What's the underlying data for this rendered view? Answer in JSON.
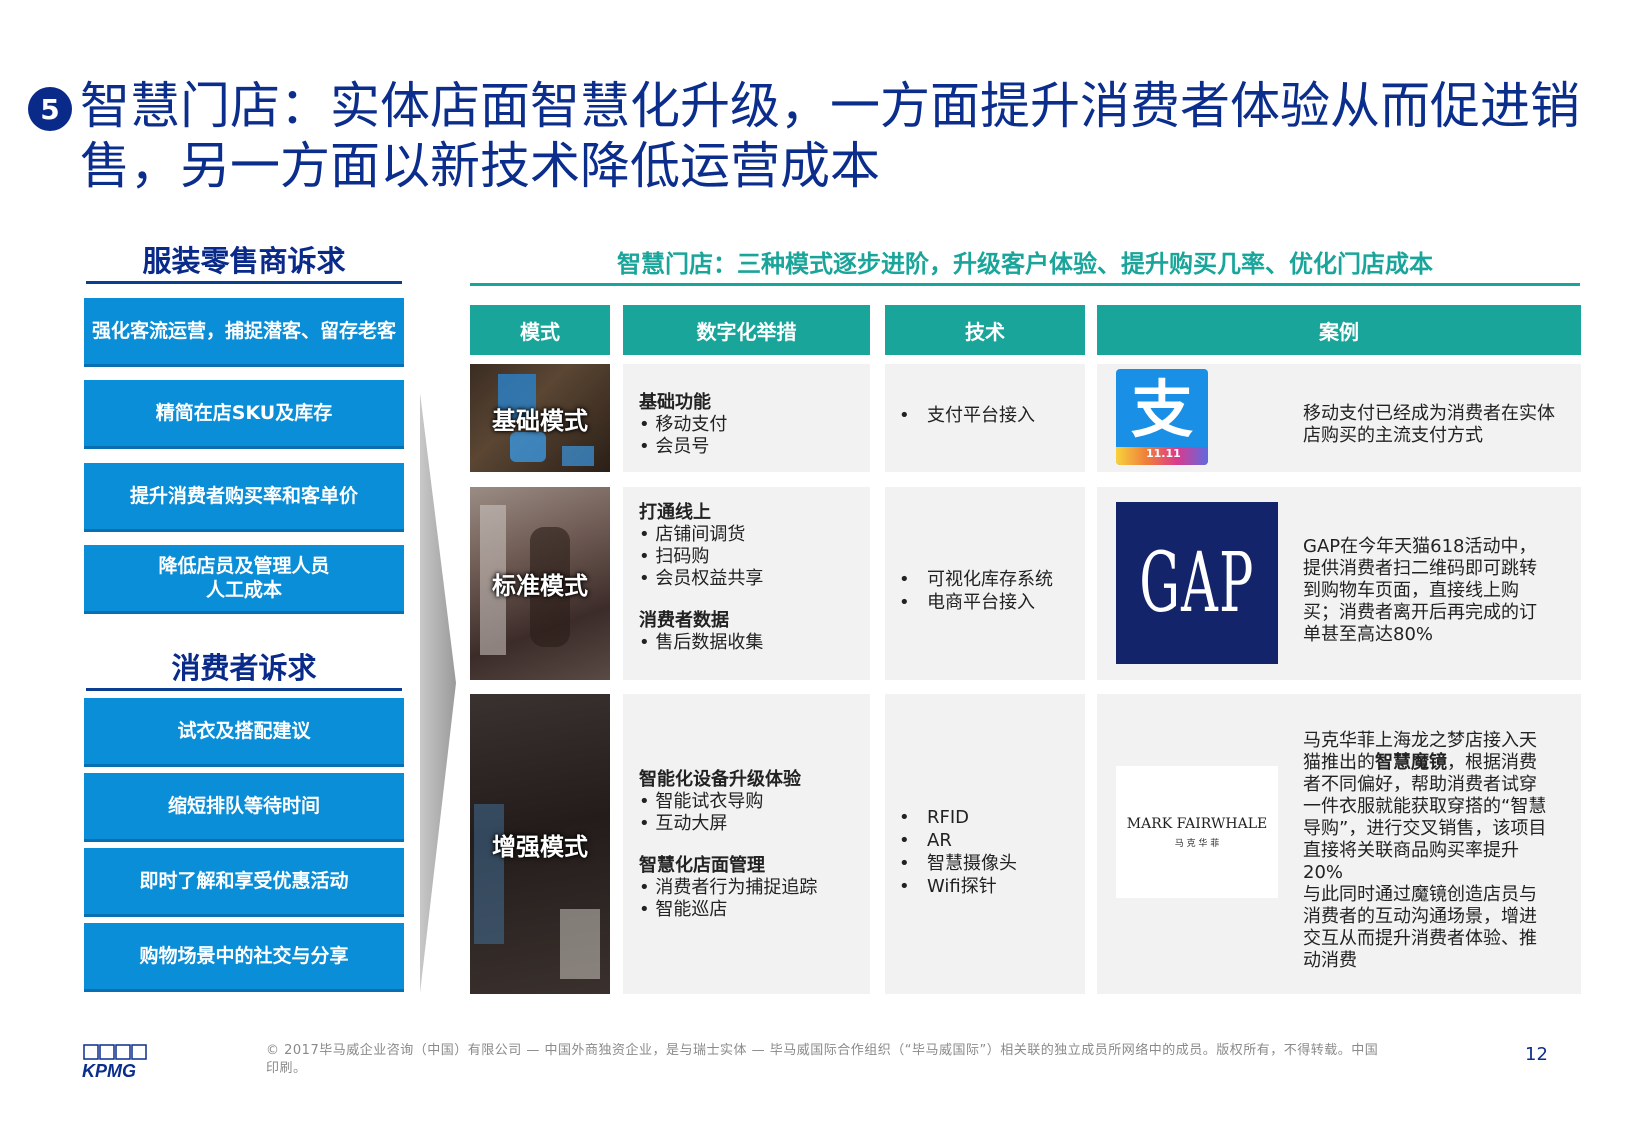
{
  "title": {
    "number": "5",
    "text": "智慧门店：实体店面智慧化升级，一方面提升消费者体验从而促进销售，另一方面以新技术降低运营成本"
  },
  "left": {
    "retailer_title": "服装零售商诉求",
    "retailer_items": [
      "强化客流运营，捕捉潜客、留存老客",
      "精简在店SKU及库存",
      "提升消费者购买率和客单价",
      "降低店员及管理人员\n人工成本"
    ],
    "consumer_title": "消费者诉求",
    "consumer_items": [
      "试衣及搭配建议",
      "缩短排队等待时间",
      "即时了解和享受优惠活动",
      "购物场景中的社交与分享"
    ]
  },
  "right": {
    "title": "智慧门店：三种模式逐步进阶，升级客户体验、提升购买几率、优化门店成本",
    "headers": [
      "模式",
      "数字化举措",
      "技术",
      "案例"
    ],
    "rows": [
      {
        "mode": "基础模式",
        "measures": [
          {
            "heading": "基础功能",
            "bullets": [
              "移动支付",
              "会员号"
            ]
          }
        ],
        "tech": [
          "支付平台接入"
        ],
        "logo_text": "支",
        "logo_subtext": "11.11",
        "case": "移动支付已经成为消费者在实体店购买的主流支付方式"
      },
      {
        "mode": "标准模式",
        "measures": [
          {
            "heading": "打通线上",
            "bullets": [
              "店铺间调货",
              "扫码购",
              "会员权益共享"
            ]
          },
          {
            "heading": "消费者数据",
            "bullets": [
              "售后数据收集"
            ]
          }
        ],
        "tech": [
          "可视化库存系统",
          "电商平台接入"
        ],
        "logo_text": "GAP",
        "case": "GAP在今年天猫618活动中，提供消费者扫二维码即可跳转到购物车页面，直接线上购买；消费者离开后再完成的订单甚至高达80%"
      },
      {
        "mode": "增强模式",
        "measures": [
          {
            "heading": "智能化设备升级体验",
            "bullets": [
              "智能试衣导购",
              "互动大屏"
            ]
          },
          {
            "heading": "智慧化店面管理",
            "bullets": [
              "消费者行为捕捉追踪",
              "智能巡店"
            ]
          }
        ],
        "tech": [
          "RFID",
          "AR",
          "智慧摄像头",
          "Wifi探针"
        ],
        "logo_text": "MARK FAIRWHALE",
        "logo_subtext": "马 克 华 菲",
        "case_parts": [
          "马克华菲上海龙之梦店接入天猫推出的",
          "智慧魔镜",
          "，根据消费者不同偏好，帮助消费者试穿一件衣服就能获取穿搭的“智慧导购”，进行交叉销售，该项目直接将关联商品购买率提升20%\n与此同时通过魔镜创造店员与消费者的互动沟通场景，增进交互从而提升消费者体验、推动消费"
        ]
      }
    ]
  },
  "footer": {
    "brand": "KPMG",
    "copyright": "© 2017毕马威企业咨询（中国）有限公司 — 中国外商独资企业，是与瑞士实体 — 毕马威国际合作组织（“毕马威国际”）相关联的独立成员所网络中的成员。版权所有，不得转载。中国印刷。",
    "page": "12"
  },
  "colors": {
    "navy": "#0b2d8c",
    "blue_button": "#0b8ed8",
    "teal": "#1aa59a",
    "cell_bg": "#f2f2f2",
    "gap_blue": "#13246b"
  }
}
